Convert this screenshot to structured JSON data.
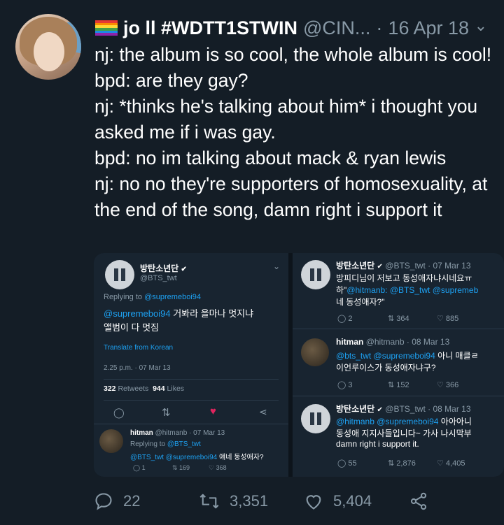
{
  "author": {
    "name": "jo ll #WDTT1STWIN",
    "handle": "@CIN...",
    "separator": "·",
    "date": "16 Apr 18"
  },
  "body_lines": [
    "nj: the album is so cool, the whole album is cool!",
    "bpd: are they gay?",
    "nj: *thinks he's talking about him* i thought you asked me if i was gay.",
    "bpd: no im talking about mack & ryan lewis",
    "nj: no no they're supporters of homosexuality, at the end of the song, damn right i support it"
  ],
  "media": {
    "left": {
      "name": "방탄소년단",
      "handle": "@BTS_twt",
      "replying_prefix": "Replying to",
      "replying_to": "@supremeboi94",
      "text_mention": "@supremeboi94",
      "text_1": "거봐라 을마나 멋지냐",
      "text_2": "앨범이 다 멋짐",
      "translate": "Translate from Korean",
      "timestamp": "2.25 p.m. · 07 Mar 13",
      "retweets_count": "322",
      "retweets_label": "Retweets",
      "likes_count": "944",
      "likes_label": "Likes",
      "reply": {
        "name": "hitman",
        "handle": "@hitmanb · 07 Mar 13",
        "replying_prefix": "Replying to",
        "replying_to": "@BTS_twt",
        "mentions": "@BTS_twt @supremeboi94",
        "text": "얘네 동성애자?",
        "replies": "1",
        "retweets": "169",
        "likes": "368"
      }
    },
    "right": {
      "t1": {
        "name": "방탄소년단",
        "meta": "@BTS_twt · 07 Mar 13",
        "line1": "방피디님이 저보고 동성애자냐시네요ㅠ",
        "line2_prefix": "하\"",
        "line2_mentions": "@hitmanb: @BTS_twt @supremeb",
        "line3": "네 동성애자?\"",
        "replies": "2",
        "retweets": "364",
        "likes": "885"
      },
      "t2": {
        "name": "hitman",
        "meta": "@hitmanb · 08 Mar 13",
        "mentions": "@bts_twt @supremeboi94",
        "line1_suffix": "아니 매클ㄹ",
        "line2": "이언루이스가 동성애자냐구?",
        "replies": "3",
        "retweets": "152",
        "likes": "366"
      },
      "t3": {
        "name": "방탄소년단",
        "meta": "@BTS_twt · 08 Mar 13",
        "mentions": "@hitmanb @supremeboi94",
        "line1_suffix": "아아아니",
        "line2": "동성애 지지사들입니다~ 가사 나시막부",
        "line3": "damn right i support it.",
        "replies": "55",
        "retweets": "2,876",
        "likes": "4,405"
      }
    }
  },
  "actions": {
    "replies": "22",
    "retweets": "3,351",
    "likes": "5,404"
  },
  "colors": {
    "background": "#141d26",
    "text_secondary": "#8899a6",
    "link": "#1da1f2",
    "like_red": "#e0245e"
  },
  "icons": {
    "reply": "reply-icon",
    "retweet": "retweet-icon",
    "like": "heart-icon",
    "share": "share-icon",
    "verified": "verified-badge-icon",
    "caret": "chevron-down-icon",
    "flag": "rainbow-flag-icon"
  }
}
